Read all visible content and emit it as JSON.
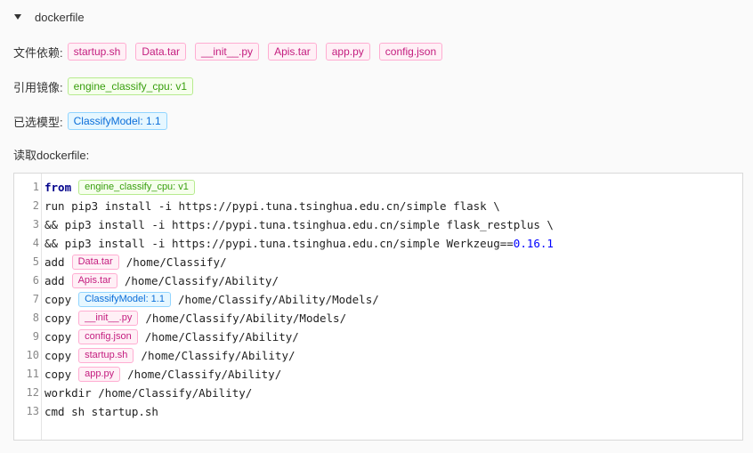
{
  "header": {
    "title": "dockerfile"
  },
  "file_deps": {
    "label": "文件依赖:",
    "files": [
      "startup.sh",
      "Data.tar",
      "__init__.py",
      "Apis.tar",
      "app.py",
      "config.json"
    ]
  },
  "image_ref": {
    "label": "引用镜像:",
    "value": "engine_classify_cpu: v1"
  },
  "model": {
    "label": "已选模型:",
    "value": "ClassifyModel: 1.1"
  },
  "read_label": "读取dockerfile:",
  "code": {
    "lines": [
      {
        "n": "1",
        "kw": "from",
        "tag": "engine_classify_cpu: v1",
        "rest": ""
      },
      {
        "n": "2",
        "text": "run pip3 install -i https://pypi.tuna.tsinghua.edu.cn/simple flask \\"
      },
      {
        "n": "3",
        "text": "&& pip3 install -i https://pypi.tuna.tsinghua.edu.cn/simple flask_restplus \\"
      },
      {
        "n": "4",
        "text": "&& pip3 install -i https://pypi.tuna.tsinghua.edu.cn/simple Werkzeug==",
        "num": "0.16.1"
      },
      {
        "n": "5",
        "cmd": "add",
        "tag": "Data.tar",
        "rest": "/home/Classify/"
      },
      {
        "n": "6",
        "cmd": "add",
        "tag": "Apis.tar",
        "rest": "/home/Classify/Ability/"
      },
      {
        "n": "7",
        "cmd": "copy",
        "tag": "ClassifyModel: 1.1",
        "rest": "/home/Classify/Ability/Models/"
      },
      {
        "n": "8",
        "cmd": "copy",
        "tag": "__init__.py",
        "rest": "/home/Classify/Ability/Models/"
      },
      {
        "n": "9",
        "cmd": "copy",
        "tag": "config.json",
        "rest": "/home/Classify/Ability/"
      },
      {
        "n": "10",
        "cmd": "copy",
        "tag": "startup.sh",
        "rest": "/home/Classify/Ability/"
      },
      {
        "n": "11",
        "cmd": "copy",
        "tag": "app.py",
        "rest": "/home/Classify/Ability/"
      },
      {
        "n": "12",
        "text": "workdir /home/Classify/Ability/"
      },
      {
        "n": "13",
        "text": "cmd sh startup.sh"
      }
    ]
  }
}
